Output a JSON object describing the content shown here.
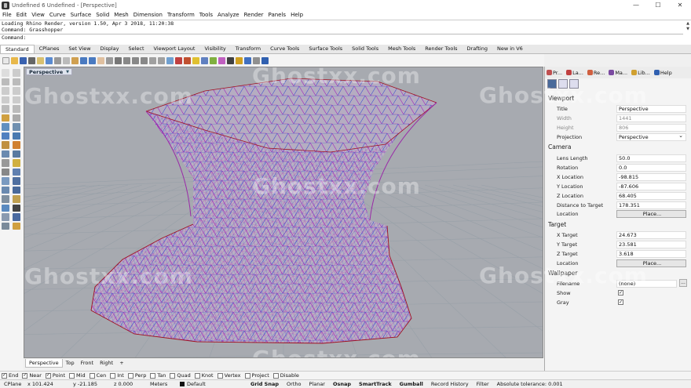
{
  "window": {
    "title": "Undefined 6 Undefined - [Perspective]",
    "minimize": "—",
    "maximize": "☐",
    "close": "✕"
  },
  "menu": [
    "File",
    "Edit",
    "View",
    "Curve",
    "Surface",
    "Solid",
    "Mesh",
    "Dimension",
    "Transform",
    "Tools",
    "Analyze",
    "Render",
    "Panels",
    "Help"
  ],
  "command": {
    "history": [
      "Loading Rhino Render, version 1.50, Apr  3 2018, 11:20:38",
      "Command: Grasshopper"
    ],
    "prompt": "Command:"
  },
  "toolbar_tabs": [
    "Standard",
    "CPlanes",
    "Set View",
    "Display",
    "Select",
    "Viewport Layout",
    "Visibility",
    "Transform",
    "Curve Tools",
    "Surface Tools",
    "Solid Tools",
    "Mesh Tools",
    "Render Tools",
    "Drafting",
    "New in V6"
  ],
  "active_toolbar_tab": "Standard",
  "viewport": {
    "label": "Perspective",
    "tabs": [
      "Perspective",
      "Top",
      "Front",
      "Right"
    ],
    "add_tab": "+"
  },
  "osnaps": [
    {
      "label": "End",
      "checked": true
    },
    {
      "label": "Near",
      "checked": true
    },
    {
      "label": "Point",
      "checked": true
    },
    {
      "label": "Mid",
      "checked": false
    },
    {
      "label": "Cen",
      "checked": false
    },
    {
      "label": "Int",
      "checked": false
    },
    {
      "label": "Perp",
      "checked": false
    },
    {
      "label": "Tan",
      "checked": false
    },
    {
      "label": "Quad",
      "checked": false
    },
    {
      "label": "Knot",
      "checked": false
    },
    {
      "label": "Vertex",
      "checked": false
    },
    {
      "label": "Project",
      "checked": false
    },
    {
      "label": "Disable",
      "checked": false
    }
  ],
  "status": {
    "cplane": "CPlane",
    "x": "x 101.424",
    "y": "y -21.185",
    "z": "z 0.000",
    "units": "Meters",
    "layer": "Default",
    "grid_snap": "Grid Snap",
    "ortho": "Ortho",
    "planar": "Planar",
    "osnap": "Osnap",
    "smarttrack": "SmartTrack",
    "gumball": "Gumball",
    "record_history": "Record History",
    "filter": "Filter",
    "tolerance": "Absolute tolerance: 0.001"
  },
  "panel": {
    "tabs": [
      "Pr...",
      "La...",
      "Re...",
      "Ma...",
      "Lib...",
      "Help"
    ],
    "viewport_title": "Viewport",
    "viewport": [
      {
        "label": "Title",
        "value": "Perspective"
      },
      {
        "label": "Width",
        "value": "1441"
      },
      {
        "label": "Height",
        "value": "806"
      },
      {
        "label": "Projection",
        "value": "Perspective"
      }
    ],
    "camera_title": "Camera",
    "camera": [
      {
        "label": "Lens Length",
        "value": "50.0"
      },
      {
        "label": "Rotation",
        "value": "0.0"
      },
      {
        "label": "X Location",
        "value": "-98.815"
      },
      {
        "label": "Y Location",
        "value": "-87.606"
      },
      {
        "label": "Z Location",
        "value": "68.405"
      },
      {
        "label": "Distance to Target",
        "value": "178.351"
      },
      {
        "label": "Location",
        "value": "Place..."
      }
    ],
    "target_title": "Target",
    "target": [
      {
        "label": "X Target",
        "value": "24.673"
      },
      {
        "label": "Y Target",
        "value": "23.581"
      },
      {
        "label": "Z Target",
        "value": "3.618"
      },
      {
        "label": "Location",
        "value": "Place..."
      }
    ],
    "wallpaper_title": "Wallpaper",
    "wallpaper": [
      {
        "label": "Filename",
        "value": "(none)"
      },
      {
        "label": "Show",
        "value": "✓"
      },
      {
        "label": "Gray",
        "value": "✓"
      }
    ],
    "filename_browse": "..."
  },
  "watermark": "Ghostxx.com",
  "colors": {
    "viewport_bg": "#a7aab0",
    "mesh_magenta": "#b030b8",
    "mesh_blue": "#4050d0",
    "edge_red": "#a01020"
  }
}
